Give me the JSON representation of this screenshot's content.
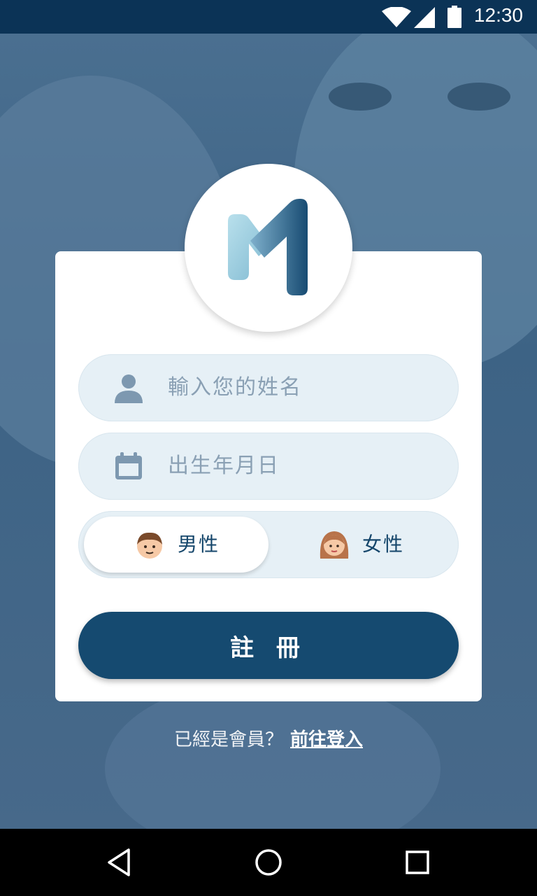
{
  "status_bar": {
    "time": "12:30",
    "icons": [
      "wifi-icon",
      "cell-signal-icon",
      "battery-icon"
    ]
  },
  "app": {
    "logo": "M"
  },
  "form": {
    "name_placeholder": "輸入您的姓名",
    "birthday_placeholder": "出生年月日",
    "gender": {
      "male_label": "男性",
      "female_label": "女性",
      "selected": "male"
    },
    "register_label": "註 冊"
  },
  "footer": {
    "question": "已經是會員？",
    "login_link": "前往登入"
  },
  "nav_bar": {
    "buttons": [
      "back-icon",
      "home-icon",
      "recents-icon"
    ]
  },
  "colors": {
    "primary": "#154a70",
    "status_bar": "#0b3356",
    "field_bg": "#e6f0f6",
    "logo_light": "#a9d6e5"
  }
}
